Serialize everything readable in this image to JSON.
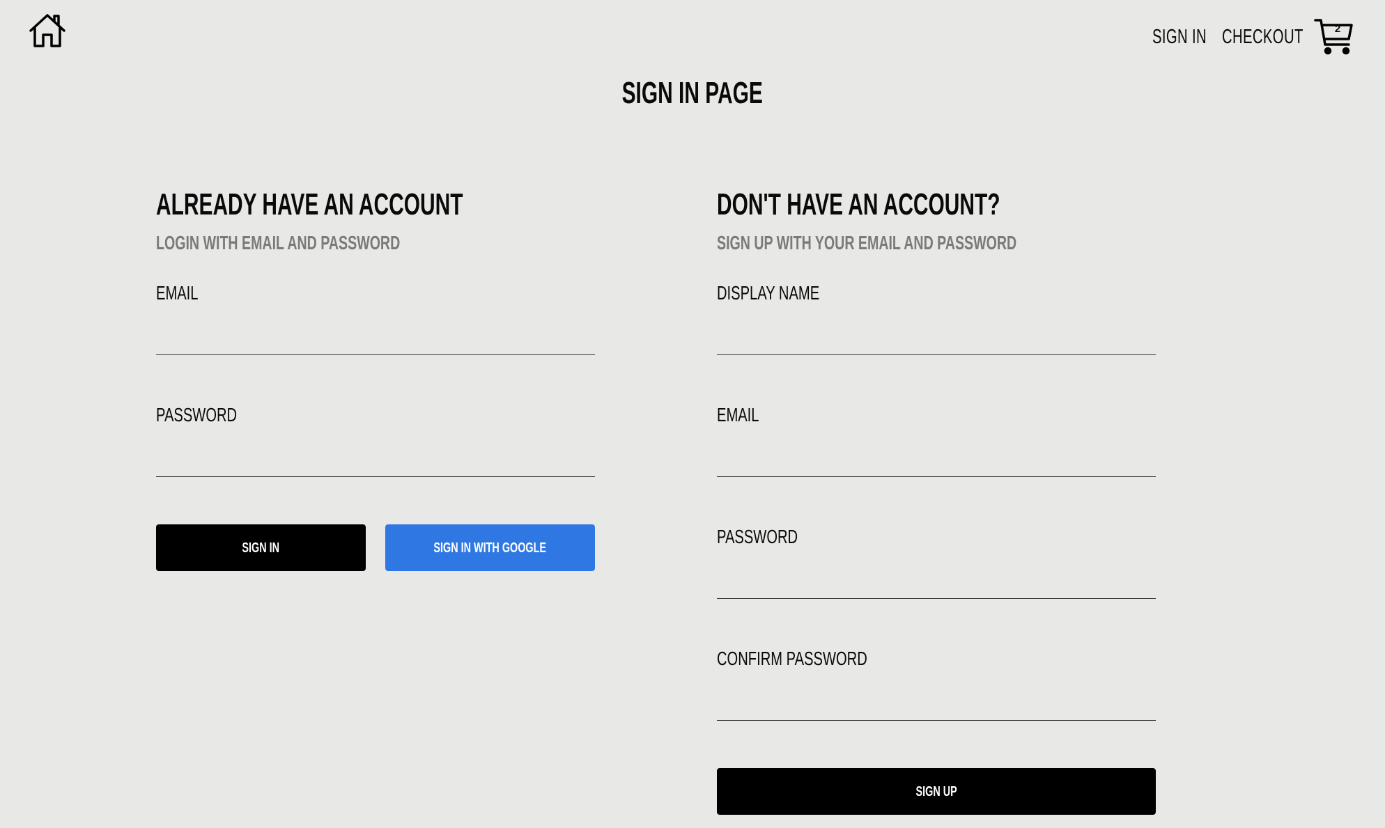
{
  "header": {
    "home_icon": "home-icon",
    "nav": {
      "sign_in": "SIGN IN",
      "checkout": "CHECKOUT"
    },
    "cart": {
      "icon": "cart-icon",
      "count": "2"
    }
  },
  "page_title": "SIGN IN PAGE",
  "sign_in_form": {
    "heading": "ALREADY HAVE AN ACCOUNT",
    "subheading": "LOGIN WITH EMAIL AND PASSWORD",
    "email_label": "EMAIL",
    "email_value": "",
    "password_label": "PASSWORD",
    "password_value": "",
    "sign_in_button": "SIGN IN",
    "google_button": "SIGN IN WITH GOOGLE",
    "google_button_color": "#2f78e4"
  },
  "sign_up_form": {
    "heading": "DON'T HAVE AN ACCOUNT?",
    "subheading": "SIGN UP WITH YOUR EMAIL AND PASSWORD",
    "display_name_label": "DISPLAY NAME",
    "display_name_value": "",
    "email_label": "EMAIL",
    "email_value": "",
    "password_label": "PASSWORD",
    "password_value": "",
    "confirm_password_label": "CONFIRM PASSWORD",
    "confirm_password_value": "",
    "sign_up_button": "SIGN UP"
  },
  "colors": {
    "background": "#e8e8e6",
    "primary_button": "#000000",
    "google_button": "#2f78e4",
    "subheading": "#7a7a7a"
  }
}
